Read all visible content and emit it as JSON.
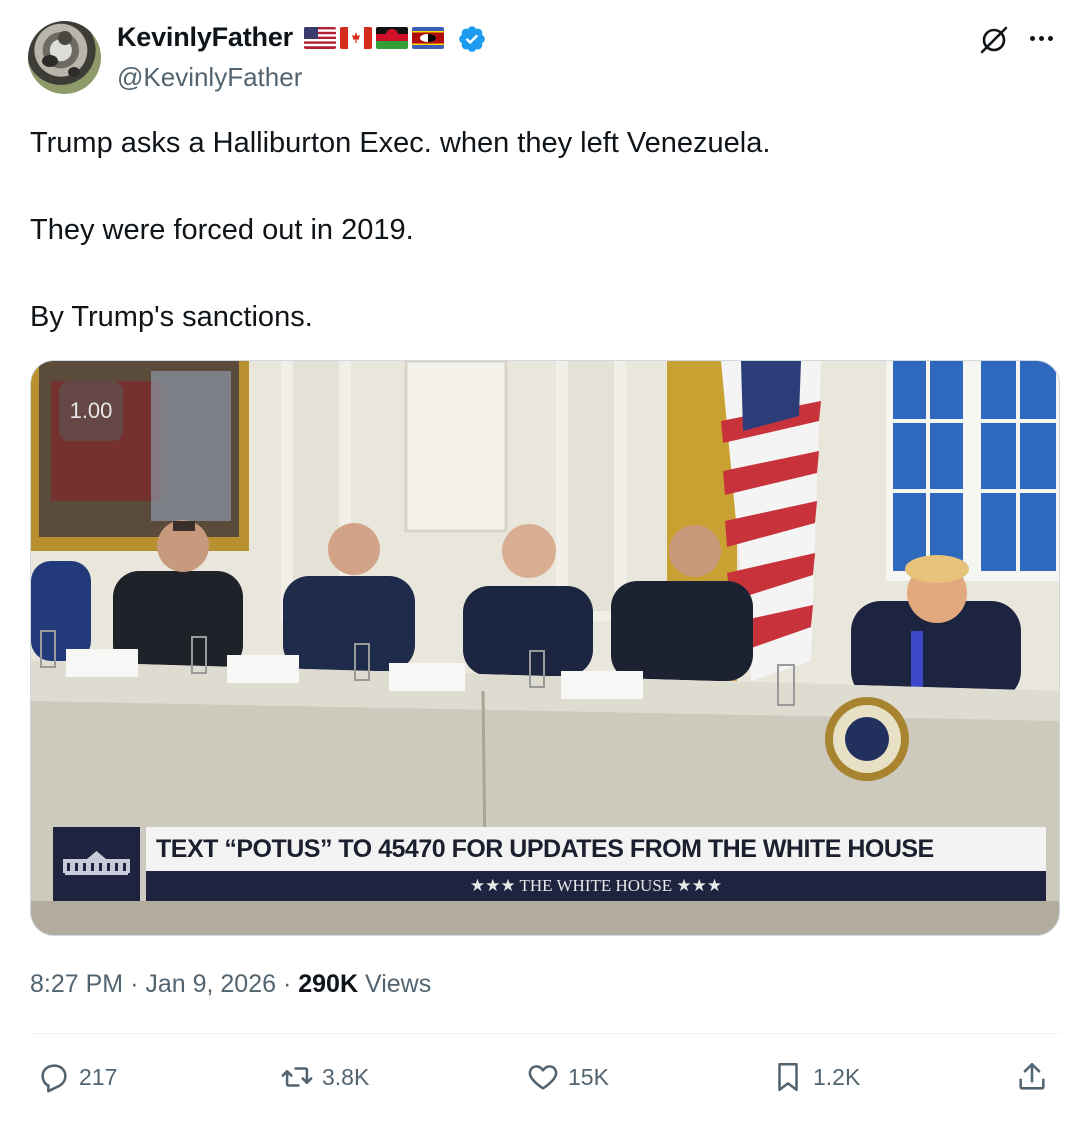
{
  "author": {
    "display_name": "KevinlyFather",
    "handle": "@KevinlyFather",
    "flags": [
      "us-flag",
      "canada-flag",
      "malawi-flag",
      "eswatini-flag"
    ],
    "verified": true
  },
  "post": {
    "paragraphs": [
      "Trump asks a Halliburton Exec. when they left Venezuela.",
      "They were forced out in 2019.",
      "By Trump's sanctions."
    ]
  },
  "media": {
    "playback_speed": "1.00",
    "banner_headline": "TEXT “POTUS” TO 45470 FOR UPDATES FROM THE WHITE HOUSE",
    "banner_footer": "★★★  THE WHITE HOUSE  ★★★"
  },
  "meta": {
    "time": "8:27 PM",
    "separator": "·",
    "date": "Jan 9, 2026",
    "views_count": "290K",
    "views_label": "Views"
  },
  "actions": {
    "replies": "217",
    "reposts": "3.8K",
    "likes": "15K",
    "bookmarks": "1.2K"
  },
  "colors": {
    "text_primary": "#0f1419",
    "text_secondary": "#536471",
    "verified_blue": "#1d9bf0",
    "divider": "#eff3f4"
  }
}
